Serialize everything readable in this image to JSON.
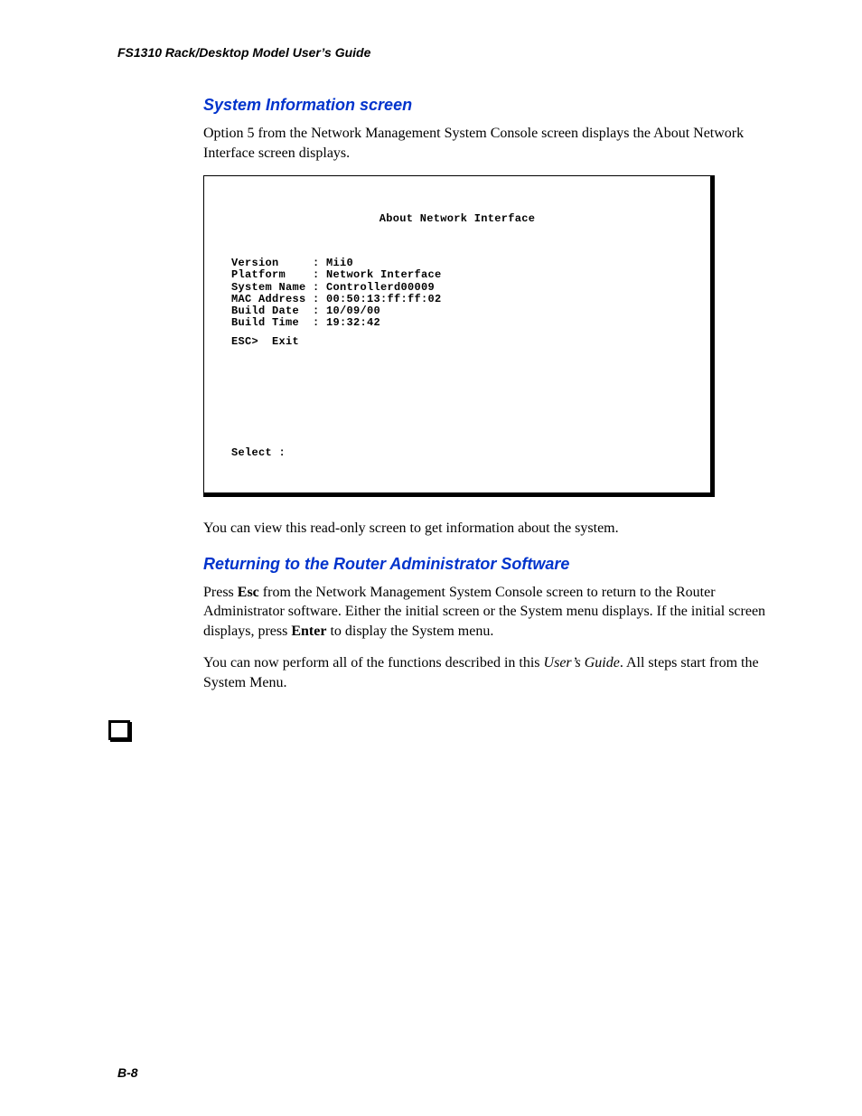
{
  "header": {
    "running": "FS1310 Rack/Desktop Model User’s Guide"
  },
  "section1": {
    "heading": "System Information screen",
    "para1": "Option 5 from the Network Management System Console screen displays the About Network Interface screen displays.",
    "para2": "You can view this read-only screen to get information about the system."
  },
  "terminal": {
    "title": "About Network Interface",
    "rows": [
      {
        "label": "Version",
        "value": "Mii0"
      },
      {
        "label": "Platform",
        "value": "Network Interface"
      },
      {
        "label": "System Name",
        "value": "Controllerd00009"
      },
      {
        "label": "MAC Address",
        "value": "00:50:13:ff:ff:02"
      },
      {
        "label": "Build Date",
        "value": "10/09/00"
      },
      {
        "label": "Build Time",
        "value": "19:32:42"
      }
    ],
    "escline": "ESC>  Exit",
    "select": "Select :"
  },
  "section2": {
    "heading": "Returning to the Router Administrator Software",
    "p1a": "Press ",
    "p1b": "Esc",
    "p1c": " from the Network Management System Console screen to return to the Router Administrator software. Either the initial screen or the System menu displays. If the initial screen displays, press ",
    "p1d": "Enter",
    "p1e": " to display the System menu.",
    "p2a": "You can now perform all of the functions described in this ",
    "p2b": "User’s Guide",
    "p2c": ". All steps start from the System Menu."
  },
  "footer": {
    "pagenum": "B-8"
  }
}
